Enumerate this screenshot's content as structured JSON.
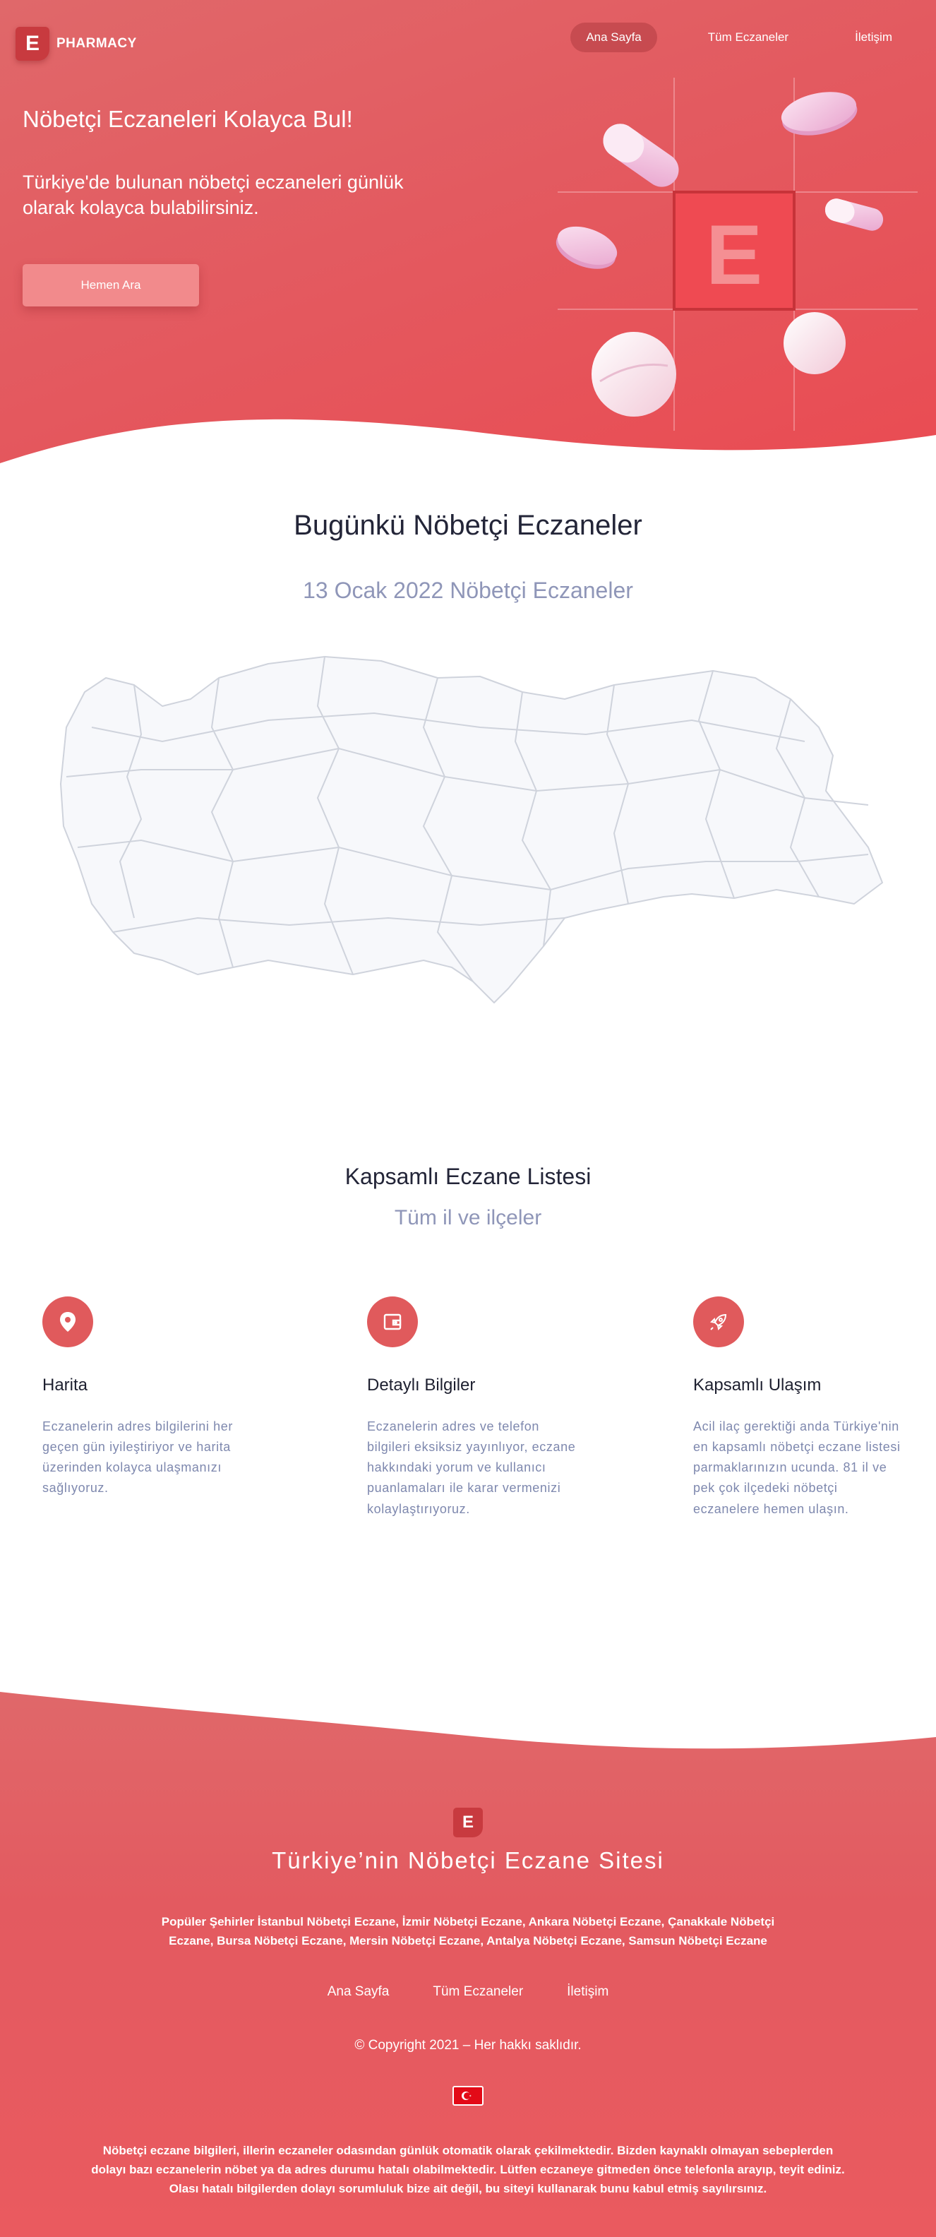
{
  "header": {
    "logo_letter": "E",
    "logo_text": "PHARMACY",
    "nav": [
      {
        "label": "Ana Sayfa",
        "active": true
      },
      {
        "label": "Tüm Eczaneler",
        "active": false
      },
      {
        "label": "İletişim",
        "active": false
      }
    ]
  },
  "hero": {
    "title": "Nöbetçi Eczaneleri Kolayca Bul!",
    "subtitle": "Türkiye'de bulunan nöbetçi eczaneleri günlük olarak kolayca bulabilirsiniz.",
    "button_label": "Hemen Ara",
    "art_letter": "E"
  },
  "today": {
    "title": "Bugünkü Nöbetçi Eczaneler",
    "date_line": "13 Ocak 2022 Nöbetçi Eczaneler"
  },
  "list": {
    "title": "Kapsamlı Eczane Listesi",
    "subtitle": "Tüm il ve ilçeler",
    "features": [
      {
        "icon": "map-pin-icon",
        "title": "Harita",
        "text": "Eczanelerin adres bilgilerini her geçen gün iyileştiriyor ve harita üzerinden kolayca ulaşmanızı sağlıyoruz."
      },
      {
        "icon": "wallet-icon",
        "title": "Detaylı Bilgiler",
        "text": "Eczanelerin adres ve telefon bilgileri eksiksiz yayınlıyor, eczane hakkındaki yorum ve kullanıcı puanlamaları ile karar vermenizi kolaylaştırıyoruz."
      },
      {
        "icon": "rocket-icon",
        "title": "Kapsamlı Ulaşım",
        "text": "Acil ilaç gerektiği anda Türkiye'nin en kapsamlı nöbetçi eczane listesi parmaklarınızın ucunda. 81 il ve pek çok ilçedeki nöbetçi eczanelere hemen ulaşın."
      }
    ]
  },
  "footer": {
    "logo_letter": "E",
    "title": "Türkiye’nin Nöbetçi Eczane Sitesi",
    "popular": "Popüler Şehirler İstanbul Nöbetçi Eczane, İzmir Nöbetçi Eczane, Ankara Nöbetçi Eczane, Çanakkale Nöbetçi Eczane, Bursa Nöbetçi Eczane, Mersin Nöbetçi Eczane, Antalya Nöbetçi Eczane, Samsun Nöbetçi Eczane",
    "nav": [
      "Ana Sayfa",
      "Tüm Eczaneler",
      "İletişim"
    ],
    "copyright": "© Copyright 2021 – Her hakkı saklıdır.",
    "flag_icon": "turkey-flag-icon",
    "disclaimer": "Nöbetçi eczane bilgileri, illerin eczaneler odasından günlük otomatik olarak çekilmektedir. Bizden kaynaklı olmayan sebeplerden dolayı bazı eczanelerin nöbet ya da adres durumu hatalı olabilmektedir. Lütfen eczaneye gitmeden önce telefonla arayıp, teyit ediniz. Olası hatalı bilgilerden dolayı sorumluluk bize ait değil, bu siteyi kullanarak bunu kabul etmiş sayılırsınız."
  },
  "colors": {
    "brand_red": "#e35a60",
    "logo_dark_red": "#c83a3f",
    "muted_text": "#8f96b8",
    "map_fill": "#f7f8fb",
    "map_stroke": "#cfd3dc"
  }
}
